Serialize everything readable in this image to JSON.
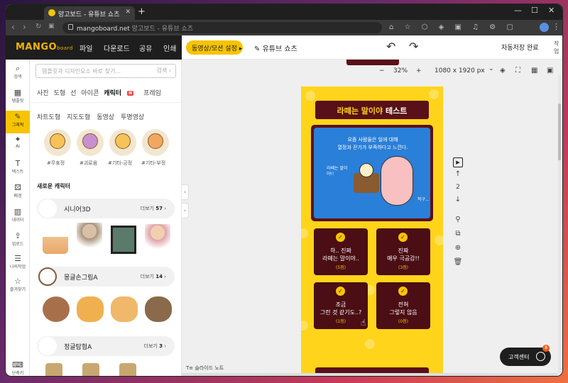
{
  "browser": {
    "tab_title": "망고보드 - 유튜브 쇼츠",
    "new_tab": "+",
    "win_min": "—",
    "win_max": "☐",
    "win_close": "✕",
    "url_domain": "mangoboard.net",
    "url_rest": " 망고보드 - 유튜브 쇼츠",
    "ext_icons": "⌂ ☆ ⬡ ◈ ▣ ♫ ⚙ ▢"
  },
  "app": {
    "logo": "MANGO",
    "logo_sub": "board",
    "menu": [
      "파일",
      "다운로드",
      "공유",
      "인쇄"
    ],
    "video_settings_btn": "동영상/모션 설정 ▸",
    "doc_name": "유튜브 쇼츠",
    "save_status": "자동저장 완료",
    "share_label": "작업"
  },
  "rail": [
    {
      "icon": "⌕",
      "label": "검색"
    },
    {
      "icon": "▦",
      "label": "템플릿"
    },
    {
      "icon": "✎",
      "label": "그래픽"
    },
    {
      "icon": "✦",
      "label": "AI"
    },
    {
      "icon": "T",
      "label": "텍스트"
    },
    {
      "icon": "⚄",
      "label": "배경"
    },
    {
      "icon": "▥",
      "label": "데이터"
    },
    {
      "icon": "⇪",
      "label": "업로드"
    },
    {
      "icon": "☰",
      "label": "나의작업"
    },
    {
      "icon": "☆",
      "label": "즐겨찾기"
    },
    {
      "icon": "⌨",
      "label": "단축키"
    }
  ],
  "panel": {
    "search_placeholder": "템플릿과 디자인요소 바로 찾기...",
    "search_btn": "검색 ›",
    "tabs": [
      "사진",
      "도형",
      "선",
      "아이콘",
      "캐릭터",
      "프레임"
    ],
    "badge": "N",
    "subtabs": [
      "차트도형",
      "지도도형",
      "동영상",
      "투명영상"
    ],
    "tags": [
      "#무표정",
      "#괴로움",
      "#기타-긍정",
      "#기타-부정"
    ],
    "new_chars": "새로운 캐릭터",
    "groups": [
      {
        "name": "시니어3D",
        "more": "더보기",
        "count": "57"
      },
      {
        "name": "몽글손그림A",
        "more": "더보기",
        "count": "14"
      },
      {
        "name": "정글탐험A",
        "more": "더보기",
        "count": "3"
      }
    ]
  },
  "editor": {
    "zoom_minus": "−",
    "zoom": "32%",
    "zoom_plus": "+",
    "size": "1080 x 1920 px",
    "size_caret": "⌄",
    "page_num": "2",
    "slide_note": "슬라이드 노트",
    "help": "고객센터",
    "help_badge": "8"
  },
  "design": {
    "title_a": "라떼는 말이야",
    "title_b": " 테스트",
    "scene_line1": "요즘 사람들은 일에 대해",
    "scene_line2": "열정과 끈기가 부족하다고 느낀다.",
    "bubble": "라떼는 말이야!!",
    "bubble2": "헉구...",
    "cards": [
      {
        "l1": "하.. 진짜",
        "l2": "라떼는 말이야..",
        "cnt": "(5점)"
      },
      {
        "l1": "진짜",
        "l2": "매우 극공감!!",
        "cnt": "(3점)"
      },
      {
        "l1": "조금",
        "l2": "그런 것 같기도..?",
        "cnt": "(1점)"
      },
      {
        "l1": "전혀",
        "l2": "그렇지 않음",
        "cnt": "(0점)"
      }
    ]
  }
}
